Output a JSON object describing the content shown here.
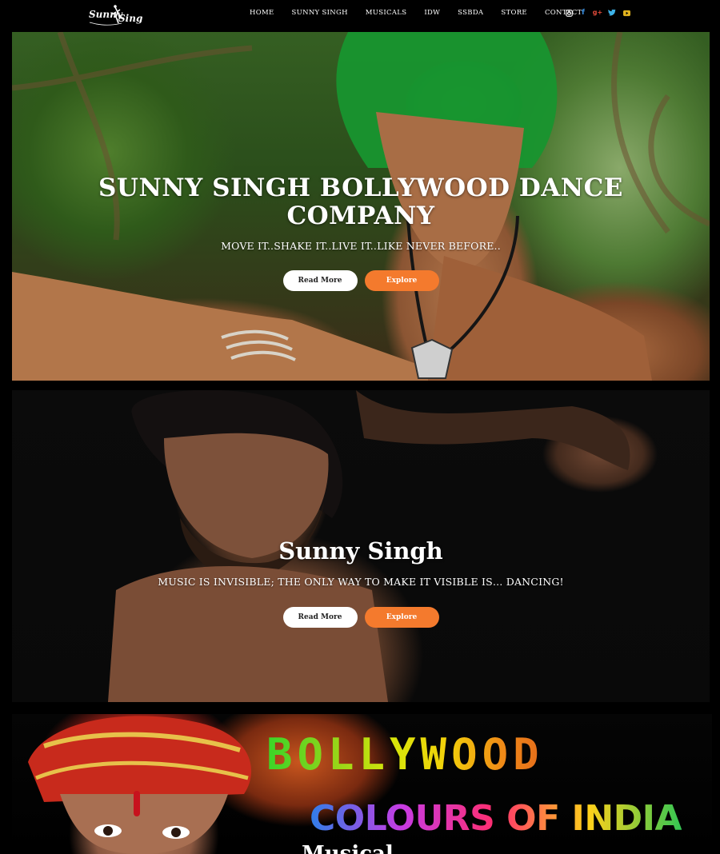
{
  "logo": {
    "text": "Sunny Singh"
  },
  "nav": [
    "HOME",
    "SUNNY SINGH",
    "MUSICALS",
    "IDW",
    "SSBDA",
    "STORE",
    "CONTACT"
  ],
  "social": [
    {
      "icon": "instagram-icon",
      "glyph": "◙"
    },
    {
      "icon": "facebook-icon",
      "glyph": "f"
    },
    {
      "icon": "google-plus-icon",
      "glyph": "g+"
    },
    {
      "icon": "twitter-icon",
      "glyph": "🐦"
    },
    {
      "icon": "youtube-icon",
      "glyph": "▶"
    }
  ],
  "hero1": {
    "title_line1": "SUNNY SINGH BOLLYWOOD DANCE",
    "title_line2": "COMPANY",
    "subtitle": "MOVE IT..SHAKE IT..LIVE IT..LIKE NEVER BEFORE..",
    "read_more": "Read More",
    "explore": "Explore"
  },
  "hero2": {
    "title": "Sunny Singh",
    "subtitle": "MUSIC IS INVISIBLE; THE ONLY WAY TO MAKE IT VISIBLE IS… DANCING!",
    "read_more": "Read More",
    "explore": "Explore"
  },
  "hero3": {
    "banner_line1": "BOLLYWOOD",
    "banner_line2": "COLOURS OF INDIA",
    "banner_line3": "Musical"
  },
  "colors": {
    "accent_orange": "#f47a2d",
    "background": "#000000"
  }
}
